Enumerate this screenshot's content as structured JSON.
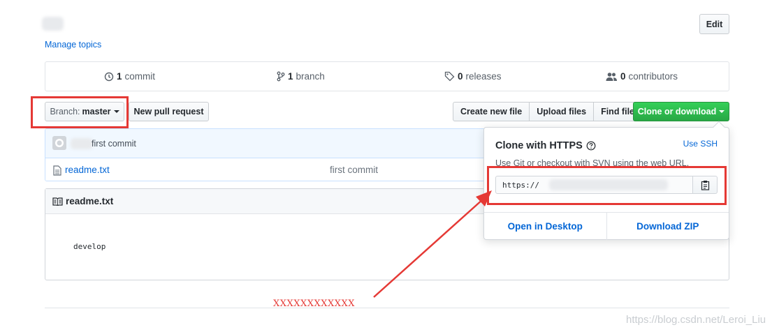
{
  "header": {
    "manage_topics": "Manage topics",
    "edit_button": "Edit"
  },
  "stats": {
    "commits": {
      "count": "1",
      "label": "commit",
      "icon": "history-icon"
    },
    "branches": {
      "count": "1",
      "label": "branch",
      "icon": "git-branch-icon"
    },
    "releases": {
      "count": "0",
      "label": "releases",
      "icon": "tag-icon"
    },
    "contributors": {
      "count": "0",
      "label": "contributors",
      "icon": "people-icon"
    }
  },
  "toolbar": {
    "branch_prefix": "Branch:",
    "branch_name": "master",
    "new_pull_request": "New pull request",
    "create_new_file": "Create new file",
    "upload_files": "Upload files",
    "find_file": "Find file",
    "clone_or_download": "Clone or download"
  },
  "commit_bar": {
    "message": "first commit"
  },
  "files": [
    {
      "name": "readme.txt",
      "commit_message": "first commit",
      "icon": "file-icon"
    }
  ],
  "readme": {
    "title": "readme.txt",
    "content": "develop",
    "icon": "book-icon"
  },
  "clone_dropdown": {
    "title": "Clone with HTTPS",
    "use_ssh": "Use SSH",
    "description": "Use Git or checkout with SVN using the web URL.",
    "url": "https://",
    "open_in_desktop": "Open in Desktop",
    "download_zip": "Download ZIP"
  },
  "annotation": {
    "text": "XXXXXXXXXXXX",
    "color": "#e53935"
  },
  "watermark": "https://blog.csdn.net/Leroi_Liu",
  "colors": {
    "accent_link": "#0366d6",
    "primary_green": "#28a745",
    "annotation_red": "#e53935"
  }
}
